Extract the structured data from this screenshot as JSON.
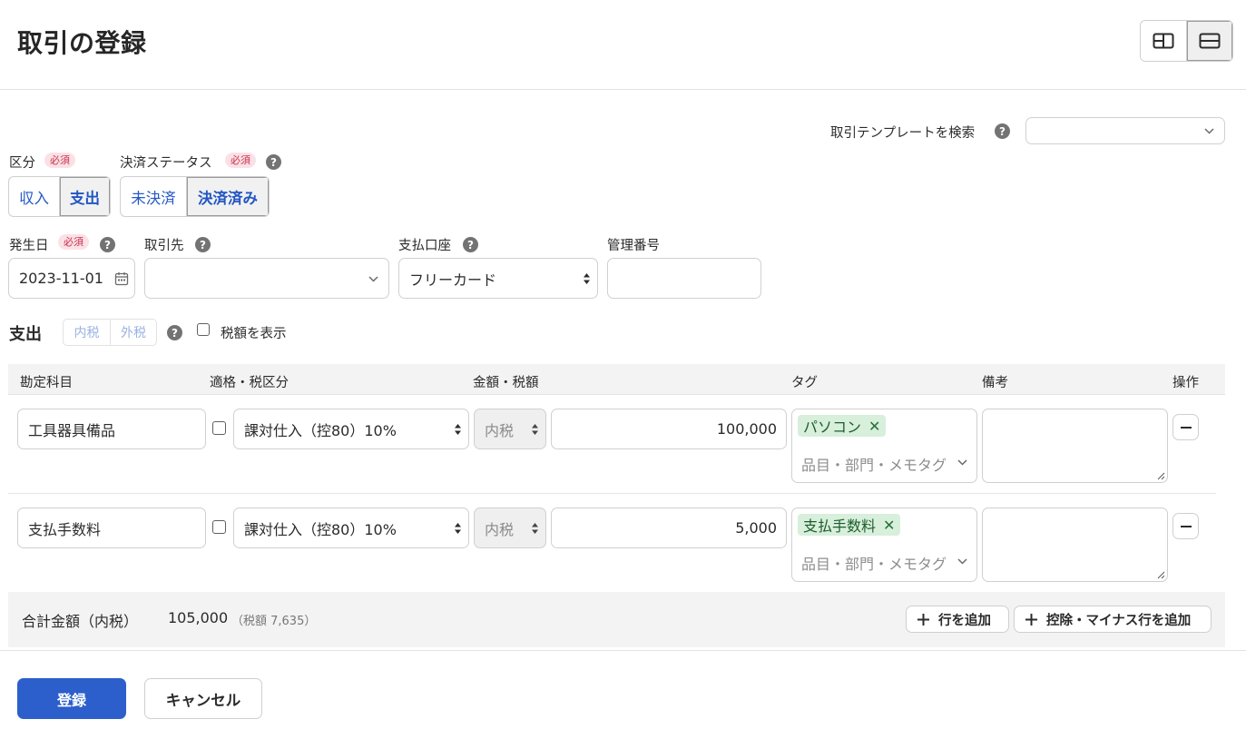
{
  "page": {
    "title": "取引の登録"
  },
  "layout_toggle": {
    "options": [
      "split-layout-icon",
      "stacked-layout-icon"
    ],
    "active": "stacked-layout-icon"
  },
  "template_search": {
    "label": "取引テンプレートを検索",
    "value": ""
  },
  "category": {
    "label": "区分",
    "required": "必須",
    "options": [
      "収入",
      "支出"
    ],
    "selected": "支出"
  },
  "settlement": {
    "label": "決済ステータス",
    "required": "必須",
    "options": [
      "未決済",
      "決済済み"
    ],
    "selected": "決済済み"
  },
  "date": {
    "label": "発生日",
    "required": "必須",
    "value": "2023-11-01"
  },
  "partner": {
    "label": "取引先",
    "value": ""
  },
  "account": {
    "label": "支払口座",
    "value": "フリーカード"
  },
  "manage_no": {
    "label": "管理番号",
    "value": ""
  },
  "section": {
    "title": "支出",
    "tax_modes": [
      "内税",
      "外税"
    ],
    "show_tax_label": "税額を表示",
    "show_tax_checked": false
  },
  "table": {
    "headers": {
      "account": "勘定科目",
      "tax": "適格・税区分",
      "amount": "金額・税額",
      "tag": "タグ",
      "memo": "備考",
      "ops": "操作"
    },
    "rows": [
      {
        "account": "工具器具備品",
        "qualified": false,
        "tax_class": "課対仕入（控80）10%",
        "tax_mode": "内税",
        "amount": "100,000",
        "tags": [
          "パソコン"
        ],
        "tag_placeholder": "品目・部門・メモタグ",
        "memo": ""
      },
      {
        "account": "支払手数料",
        "qualified": false,
        "tax_class": "課対仕入（控80）10%",
        "tax_mode": "内税",
        "amount": "5,000",
        "tags": [
          "支払手数料"
        ],
        "tag_placeholder": "品目・部門・メモタグ",
        "memo": ""
      }
    ]
  },
  "summary": {
    "label": "合計金額（内税）",
    "total": "105,000",
    "tax_note": "（税額 7,635）"
  },
  "actions": {
    "add_row": "行を追加",
    "add_minus_row": "控除・マイナス行を追加",
    "submit": "登録",
    "cancel": "キャンセル"
  },
  "icons": {
    "help": "?",
    "remove_tag": "✕",
    "plus": "+"
  },
  "colors": {
    "primary": "#2c5fcb",
    "accent_text": "#2559c6",
    "required_bg": "#fbe1e6",
    "required_text": "#c8304c",
    "tag_bg": "#d7efdb"
  }
}
